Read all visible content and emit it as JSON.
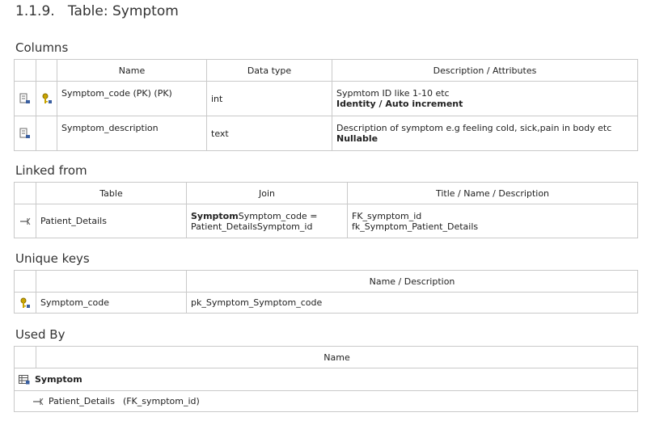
{
  "page": {
    "number": "1.1.9.",
    "title": "Table: Symptom"
  },
  "columns": {
    "heading": "Columns",
    "headers": {
      "name": "Name",
      "type": "Data type",
      "desc": "Description / Attributes"
    },
    "rows": [
      {
        "name": "Symptom_code (PK) (PK)",
        "type": "int",
        "desc": "Sypmtom ID like 1-10 etc",
        "attr": "Identity / Auto increment"
      },
      {
        "name": "Symptom_description",
        "type": "text",
        "desc": "Description of symptom e.g feeling cold, sick,pain in body etc",
        "attr": "Nullable"
      }
    ]
  },
  "linked_from": {
    "heading": "Linked from",
    "headers": {
      "table": "Table",
      "join": "Join",
      "title": "Title / Name / Description"
    },
    "rows": [
      {
        "table": "Patient_Details",
        "join_bold": "Symptom",
        "join_rest": "Symptom_code =",
        "join_line2": "Patient_DetailsSymptom_id",
        "title1": "FK_symptom_id",
        "title2": "fk_Symptom_Patient_Details"
      }
    ]
  },
  "unique_keys": {
    "heading": "Unique keys",
    "headers": {
      "desc": "Name / Description"
    },
    "rows": [
      {
        "column": "Symptom_code",
        "name": "pk_Symptom_Symptom_code"
      }
    ]
  },
  "used_by": {
    "heading": "Used By",
    "headers": {
      "name": "Name"
    },
    "table": "Symptom",
    "ref": "Patient_Details",
    "ref_key": "(FK_symptom_id)"
  },
  "colors": {
    "border": "#c9c9c9",
    "key_icon": "#c9a400",
    "column_icon": "#3a5fa0"
  }
}
